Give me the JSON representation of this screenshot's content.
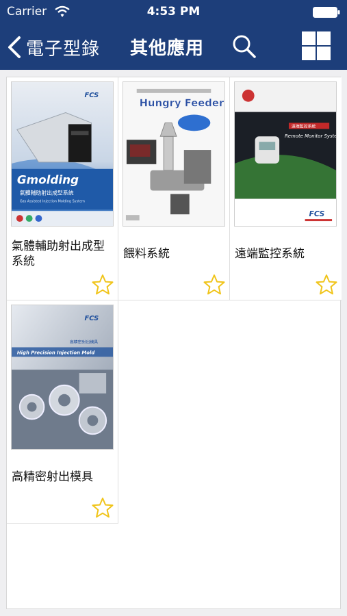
{
  "status_bar": {
    "carrier": "Carrier",
    "time": "4:53 PM"
  },
  "nav": {
    "back_label": "電子型錄",
    "title": "其他應用",
    "search_icon": "search-icon",
    "grid_icon": "grid-view-icon"
  },
  "colors": {
    "nav_background": "#1d3e7a",
    "star": "#f0c419",
    "content_background": "#efeff1"
  },
  "catalogs": [
    {
      "title": "氣體輔助射出成型系統",
      "cover": {
        "brand": "FCS",
        "product": "Gmolding",
        "subtitle_zh": "氣體輔助射出成型系統",
        "subtitle_en": "Gas Assisted Injection Molding System"
      }
    },
    {
      "title": "餵料系統",
      "cover": {
        "product": "Hungry Feeder"
      }
    },
    {
      "title": "遠端監控系統",
      "cover": {
        "product": "Remote Monitor System",
        "subtitle_zh": "遠端監控系統",
        "brand": "FCS"
      }
    },
    {
      "title": "高精密射出模具",
      "cover": {
        "brand": "FCS",
        "product": "High Precision Injection Mold",
        "subtitle_zh": "高精密射出模具"
      }
    }
  ]
}
